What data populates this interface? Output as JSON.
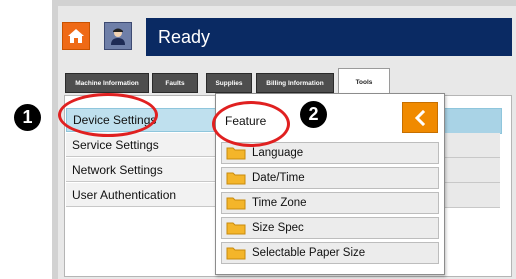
{
  "header": {
    "status": "Ready"
  },
  "tabs": [
    {
      "label": "Machine Information"
    },
    {
      "label": "Faults"
    },
    {
      "label": "Supplies"
    },
    {
      "label": "Billing Information"
    },
    {
      "label": "Tools"
    }
  ],
  "sidebar": {
    "items": [
      {
        "label": "Device Settings"
      },
      {
        "label": "Service Settings"
      },
      {
        "label": "Network Settings"
      },
      {
        "label": "User Authentication"
      }
    ]
  },
  "popup": {
    "title": "Feature",
    "items": [
      {
        "label": "Language"
      },
      {
        "label": "Date/Time"
      },
      {
        "label": "Time Zone"
      },
      {
        "label": "Size Spec"
      },
      {
        "label": "Selectable Paper Size"
      }
    ]
  },
  "callouts": [
    "1",
    "2"
  ],
  "colors": {
    "status_bar": "#0a2a63",
    "home_button": "#ef6a16",
    "back_button": "#f08a00",
    "highlight": "#e02020"
  }
}
